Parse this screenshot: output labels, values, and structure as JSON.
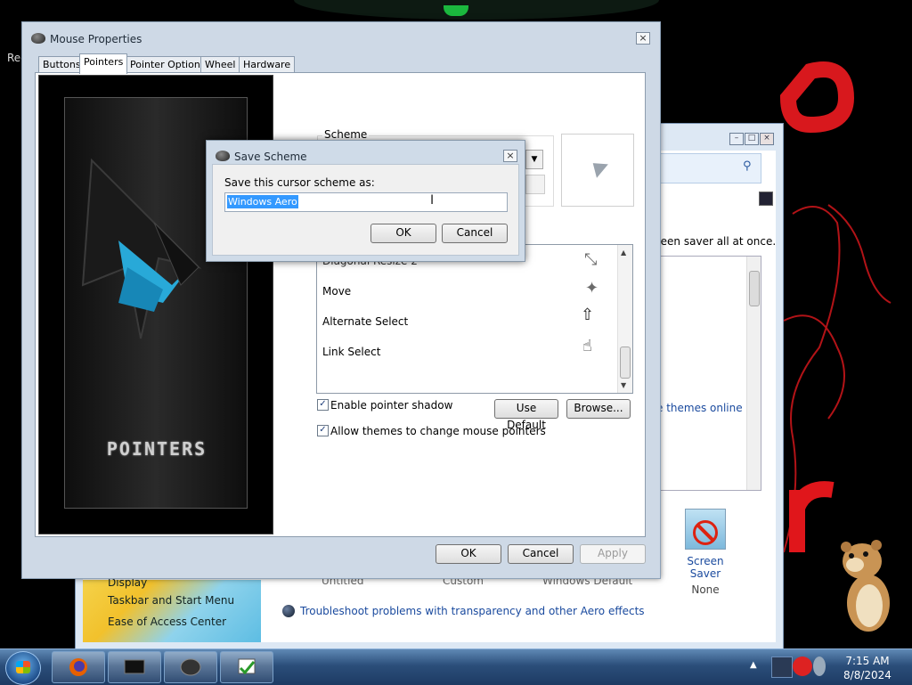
{
  "desktop": {
    "left_text": "Rec",
    "accent_color": "#e0161b"
  },
  "personalization": {
    "search_fragment": "t",
    "description_fragment": "reen saver all at once.",
    "online_link": "e themes online",
    "left_panel_items": [
      "Display",
      "Taskbar and Start Menu",
      "Ease of Access Center"
    ],
    "theme_captions": [
      "Untitled",
      "Custom",
      "Windows Default"
    ],
    "screen_saver_label": "Screen Saver",
    "screen_saver_value": "None",
    "troubleshoot_link": "Troubleshoot problems with transparency and other Aero effects"
  },
  "mouse_properties": {
    "title": "Mouse Properties",
    "tabs": [
      "Buttons",
      "Pointers",
      "Pointer Options",
      "Wheel",
      "Hardware"
    ],
    "active_tab": "Pointers",
    "art_label": "POINTERS",
    "scheme_label": "Scheme",
    "cursor_items": [
      {
        "label": "Diagonal Resize 2",
        "icon": "diagonal-resize-icon"
      },
      {
        "label": "Move",
        "icon": "move-icon"
      },
      {
        "label": "Alternate Select",
        "icon": "up-arrow-icon"
      },
      {
        "label": "Link Select",
        "icon": "hand-icon"
      }
    ],
    "enable_shadow_label": "Enable pointer shadow",
    "enable_shadow_checked": true,
    "allow_themes_label": "Allow themes to change mouse pointers",
    "allow_themes_checked": true,
    "use_default_label": "Use Default",
    "browse_label": "Browse...",
    "ok_label": "OK",
    "cancel_label": "Cancel",
    "apply_label": "Apply"
  },
  "save_scheme": {
    "title": "Save Scheme",
    "prompt": "Save this cursor scheme as:",
    "input_value": "Windows Aero",
    "ok_label": "OK",
    "cancel_label": "Cancel"
  },
  "taskbar": {
    "time": "7:15 AM",
    "date": "8/8/2024",
    "buttons": [
      "firefox-icon",
      "screen-icon",
      "mouse-icon",
      "personalization-icon"
    ]
  }
}
